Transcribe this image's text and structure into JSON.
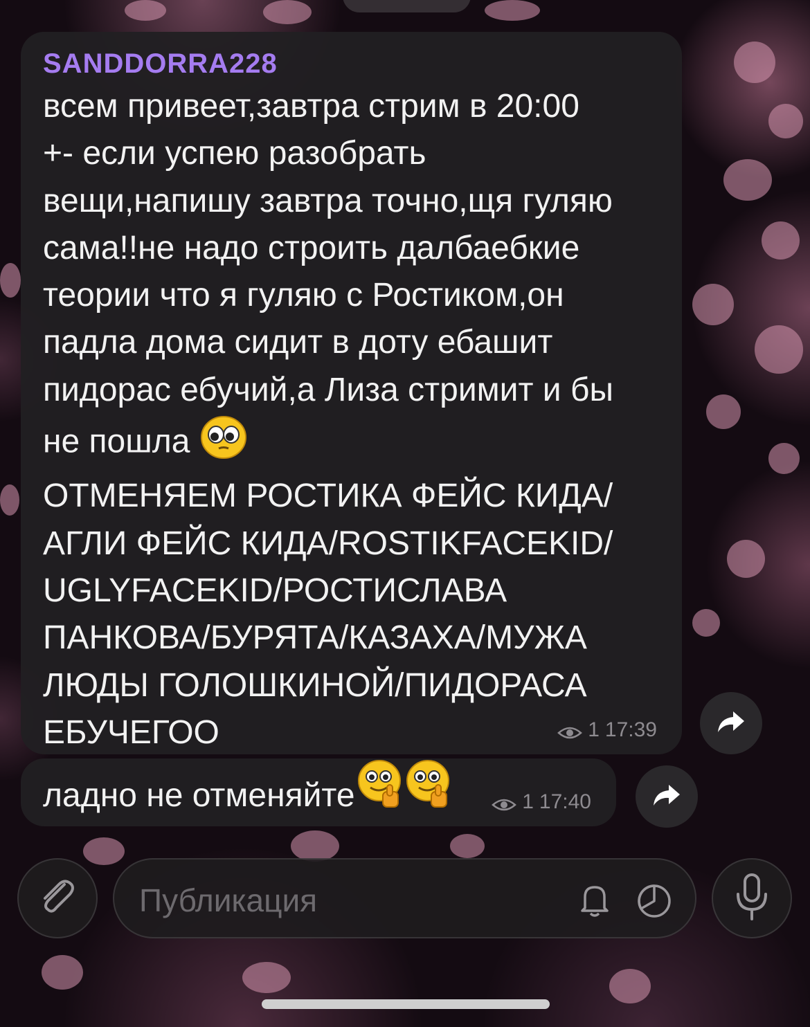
{
  "messages": [
    {
      "author": "SANDDORRA228",
      "lines": [
        "всем привеет,завтра стрим в 20:00",
        "+- если успею разобрать",
        "вещи,напишу завтра точно,щя гуляю",
        "сама!!не надо строить далбаебкие",
        "теории что я гуляю с Ростиком,он",
        "падла дома сидит в доту ебашит",
        "пидорас ебучий,а Лиза стримит и бы",
        "не пошла",
        "ОТМЕНЯЕМ РОСТИКА ФЕЙС КИДА/",
        "АГЛИ ФЕЙС КИДА/ROSTIKFACEKID/",
        "UGLYFACEKID/РОСТИСЛАВА",
        "ПАНКОВА/БУРЯТА/КАЗАХА/МУЖА",
        "ЛЮДЫ ГОЛОШКИНОЙ/ПИДОРАСА",
        "ЕБУЧЕГОО"
      ],
      "emoji": "big-eyes-emoji",
      "views": "1",
      "time": "17:39"
    },
    {
      "text": "ладно не отменяйте",
      "emojis": [
        "thumbs-up-smile-emoji",
        "thumbs-up-smile-emoji"
      ],
      "views": "1",
      "time": "17:40"
    }
  ],
  "composer": {
    "placeholder": "Публикация"
  },
  "colors": {
    "author": "#a57cf0",
    "bubble": "#211f22",
    "meta": "#8e8b90"
  }
}
